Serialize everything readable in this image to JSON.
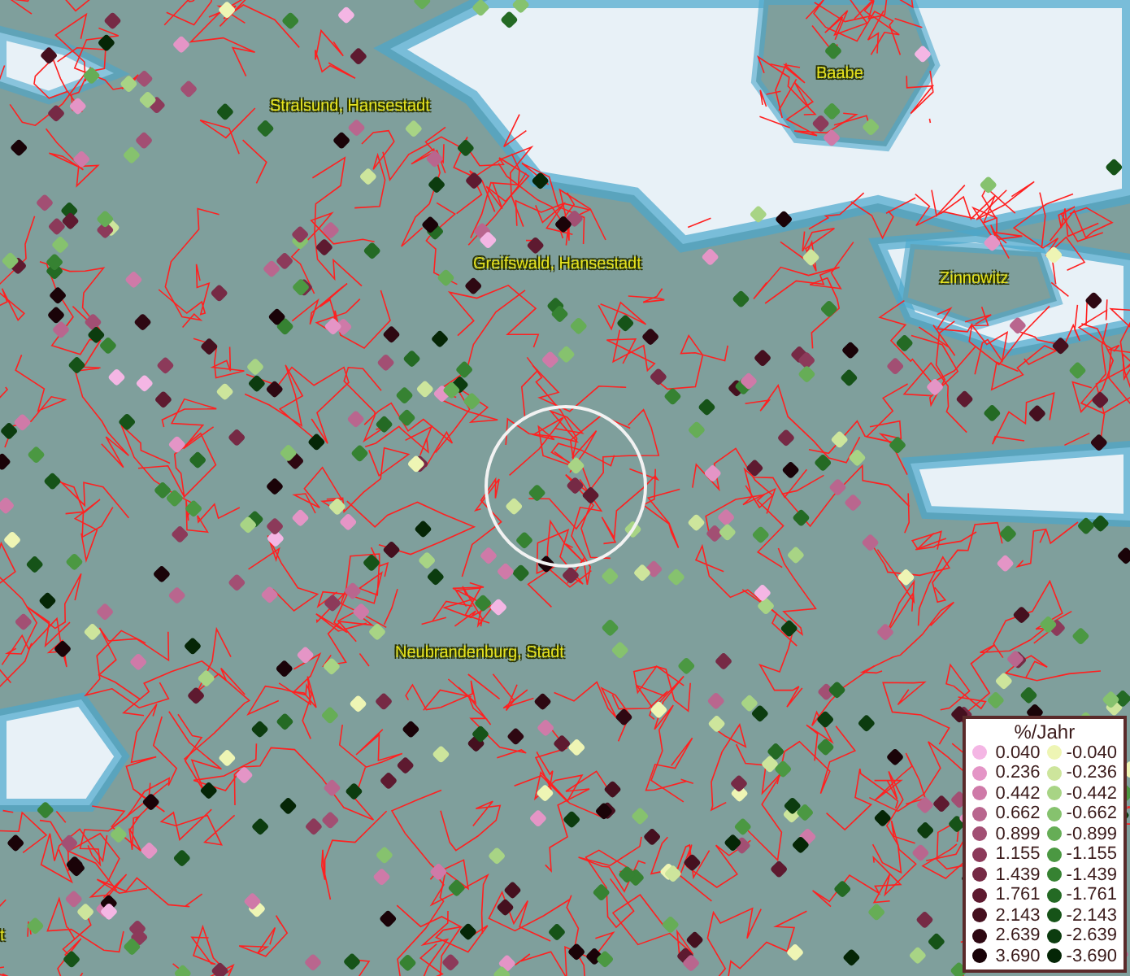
{
  "map": {
    "places": [
      {
        "name": "Baabe"
      },
      {
        "name": "Stralsund, Hansestadt"
      },
      {
        "name": "Greifswald, Hansestadt"
      },
      {
        "name": "Zinnowitz"
      },
      {
        "name": "Neubrandenburg, Stadt"
      },
      {
        "name": "t"
      }
    ]
  },
  "legend": {
    "title": "%/Jahr",
    "positive": [
      {
        "value": "0.040",
        "color": "#f4b6e4"
      },
      {
        "value": "0.236",
        "color": "#e495c6"
      },
      {
        "value": "0.442",
        "color": "#cf7aa8"
      },
      {
        "value": "0.662",
        "color": "#b9668e"
      },
      {
        "value": "0.899",
        "color": "#a24f73"
      },
      {
        "value": "1.155",
        "color": "#8c3a5a"
      },
      {
        "value": "1.439",
        "color": "#762a45"
      },
      {
        "value": "1.761",
        "color": "#5e1a30"
      },
      {
        "value": "2.143",
        "color": "#45101f"
      },
      {
        "value": "2.639",
        "color": "#2e0812"
      },
      {
        "value": "3.690",
        "color": "#1a0308"
      }
    ],
    "negative": [
      {
        "value": "-0.040",
        "color": "#eef5b4"
      },
      {
        "value": "-0.236",
        "color": "#cde59c"
      },
      {
        "value": "-0.442",
        "color": "#a8d485"
      },
      {
        "value": "-0.662",
        "color": "#86c26e"
      },
      {
        "value": "-0.899",
        "color": "#66ad56"
      },
      {
        "value": "-1.155",
        "color": "#4b9842"
      },
      {
        "value": "-1.439",
        "color": "#368232"
      },
      {
        "value": "-1.761",
        "color": "#246a24"
      },
      {
        "value": "-2.143",
        "color": "#165318"
      },
      {
        "value": "-2.639",
        "color": "#0c3c0f"
      },
      {
        "value": "-3.690",
        "color": "#052606"
      }
    ]
  }
}
